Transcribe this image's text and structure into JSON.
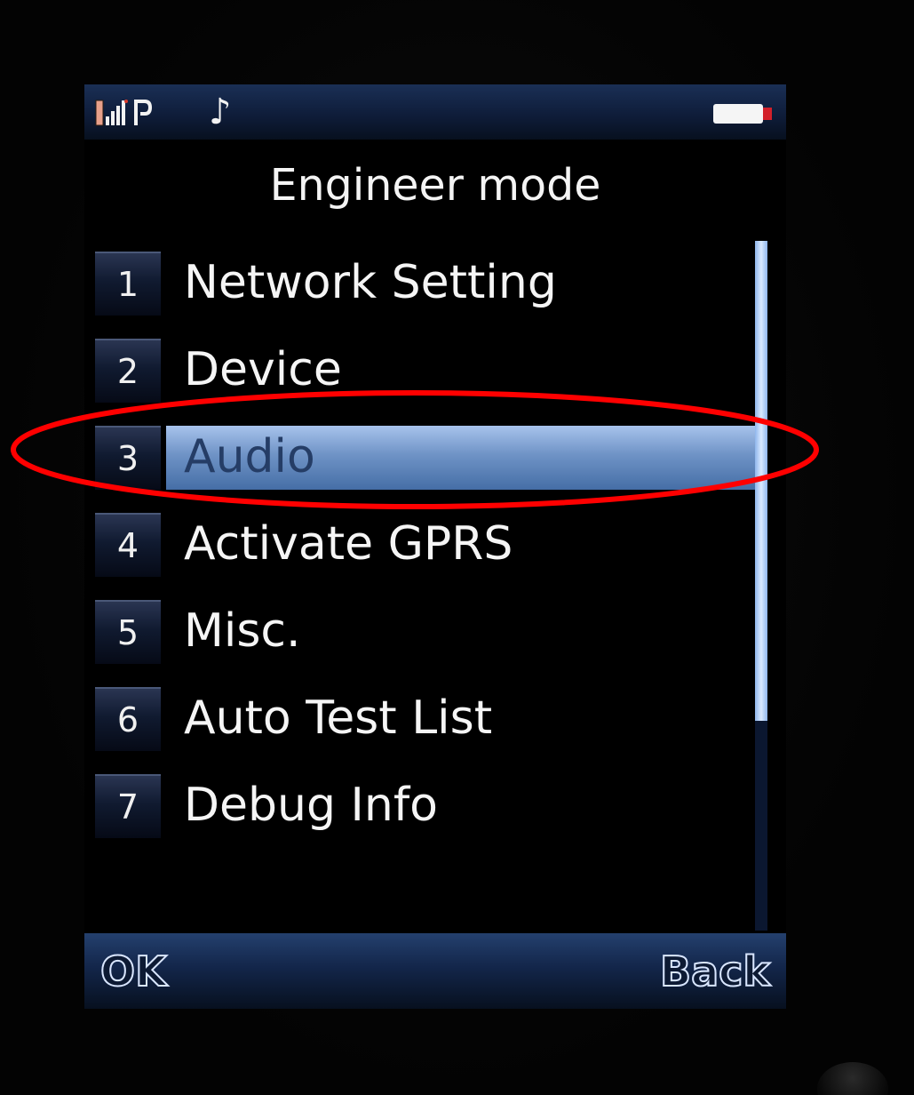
{
  "status_bar": {
    "signal_icon": "signal-strength-icon",
    "gprs_icon": "gprs-icon",
    "note_glyph": "♪",
    "battery_icon": "battery-icon"
  },
  "title": "Engineer mode",
  "menu": {
    "items": [
      {
        "num": "1",
        "label": "Network Setting"
      },
      {
        "num": "2",
        "label": "Device"
      },
      {
        "num": "3",
        "label": "Audio"
      },
      {
        "num": "4",
        "label": "Activate GPRS"
      },
      {
        "num": "5",
        "label": "Misc."
      },
      {
        "num": "6",
        "label": "Auto Test List"
      },
      {
        "num": "7",
        "label": "Debug Info"
      }
    ],
    "selected": "3"
  },
  "softkeys": {
    "left": "OK",
    "right": "Back"
  },
  "colors": {
    "highlight": "#6f93c6",
    "annotation": "#ff0000",
    "scrollbar": "#b5d1f7"
  }
}
